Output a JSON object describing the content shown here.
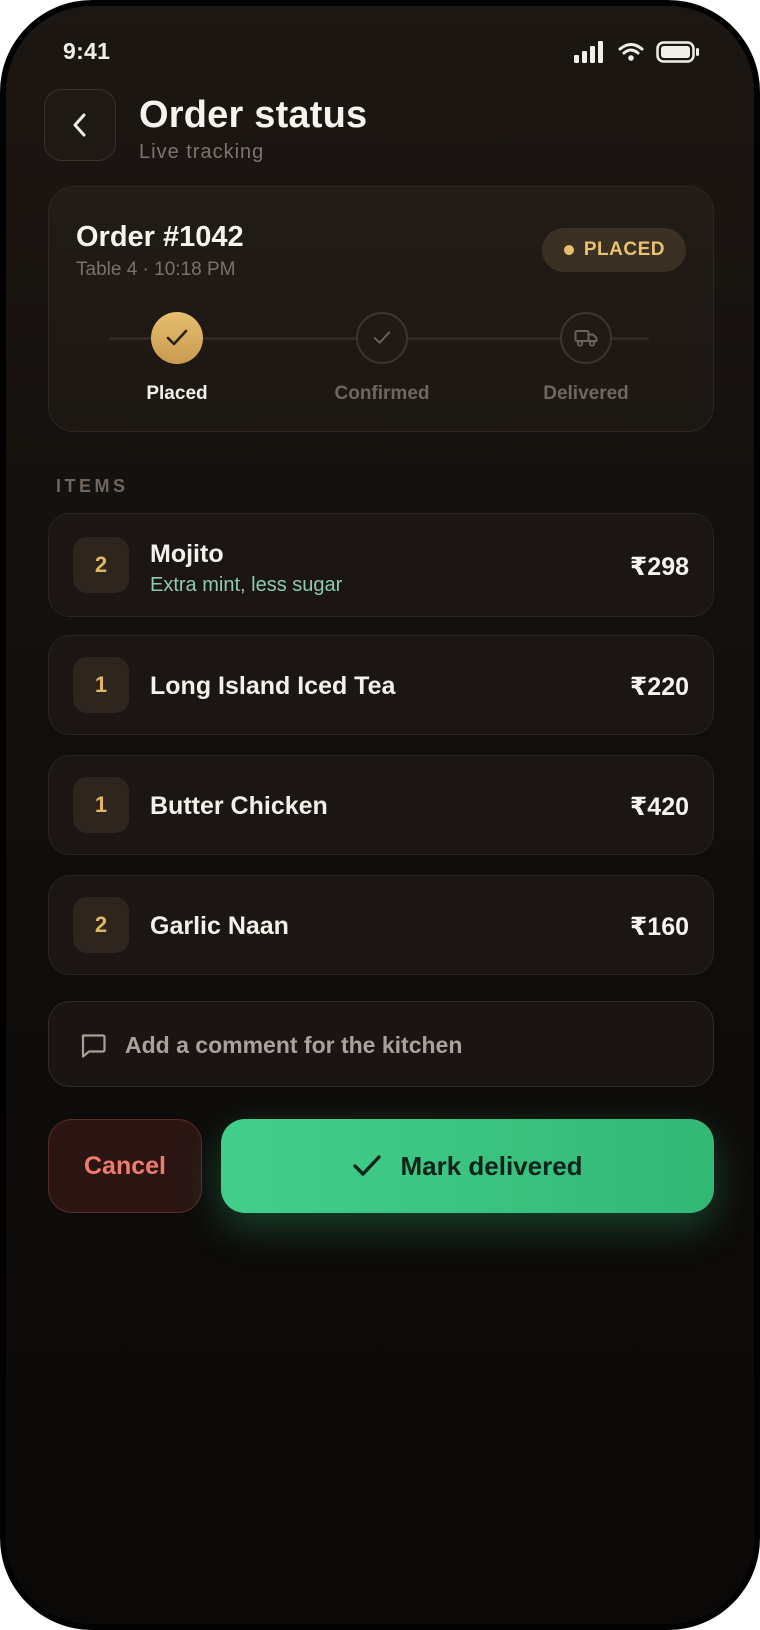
{
  "status_bar": {
    "time": "9:41"
  },
  "header": {
    "title": "Order status",
    "subtitle": "Live tracking"
  },
  "order": {
    "number": "Order #1042",
    "meta": "Table 4 · 10:18 PM",
    "status": "PLACED",
    "steps": [
      {
        "label": "Placed",
        "state": "done"
      },
      {
        "label": "Confirmed",
        "state": "pending"
      },
      {
        "label": "Delivered",
        "state": "pending"
      }
    ]
  },
  "items_section": {
    "label": "ITEMS"
  },
  "items": [
    {
      "qty": "2",
      "name": "Mojito",
      "note": "Extra mint, less sugar",
      "price": "₹298"
    },
    {
      "qty": "1",
      "name": "Long Island Iced Tea",
      "note": "",
      "price": "₹220"
    },
    {
      "qty": "1",
      "name": "Butter Chicken",
      "note": "",
      "price": "₹420"
    },
    {
      "qty": "2",
      "name": "Garlic Naan",
      "note": "",
      "price": "₹160"
    }
  ],
  "comment": {
    "placeholder": "Add a comment for the kitchen"
  },
  "actions": {
    "cancel_label": "Cancel",
    "deliver_label": "Mark delivered"
  },
  "colors": {
    "accent_gold": "#e6be70",
    "success_green": "#3dc583",
    "danger_red": "#ef7b6f",
    "note_teal": "#8ec9b6"
  },
  "icons": {
    "back": "chevron-left-icon",
    "step_done": "check-icon",
    "step_confirmed": "check-icon",
    "step_delivered": "truck-icon",
    "comment": "chat-bubble-icon",
    "deliver": "check-icon"
  }
}
